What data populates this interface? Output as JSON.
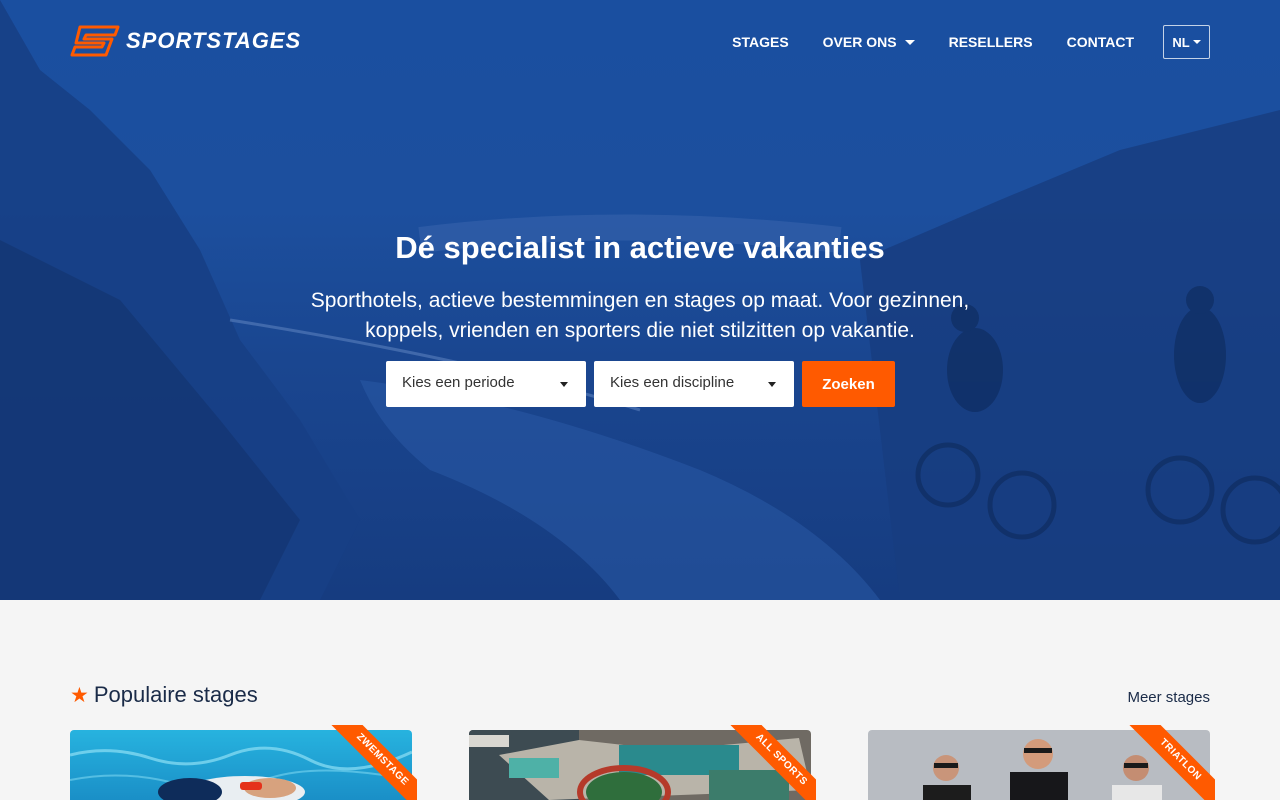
{
  "brand": {
    "name": "SPORTSTAGES",
    "accent_color": "#ff5a00",
    "primary_color": "#1a4fa0"
  },
  "nav": {
    "items": [
      {
        "label": "STAGES"
      },
      {
        "label": "OVER ONS",
        "has_dropdown": true
      },
      {
        "label": "RESELLERS"
      },
      {
        "label": "CONTACT"
      }
    ],
    "language": "NL"
  },
  "hero": {
    "title": "Dé specialist in actieve vakanties",
    "subtitle": "Sporthotels, actieve bestemmingen en stages op maat. Voor gezinnen, koppels, vrienden en sporters die niet stilzitten op vakantie.",
    "period_select": "Kies een periode",
    "discipline_select": "Kies een discipline",
    "search_button": "Zoeken"
  },
  "popular": {
    "title": "Populaire stages",
    "more_link": "Meer stages",
    "cards": [
      {
        "tag": "ZWEMSTAGE",
        "image": "swimmer-in-pool"
      },
      {
        "tag": "ALL SPORTS",
        "image": "aerial-sports-resort"
      },
      {
        "tag": "TRIATLON",
        "image": "group-of-athletes"
      }
    ]
  }
}
